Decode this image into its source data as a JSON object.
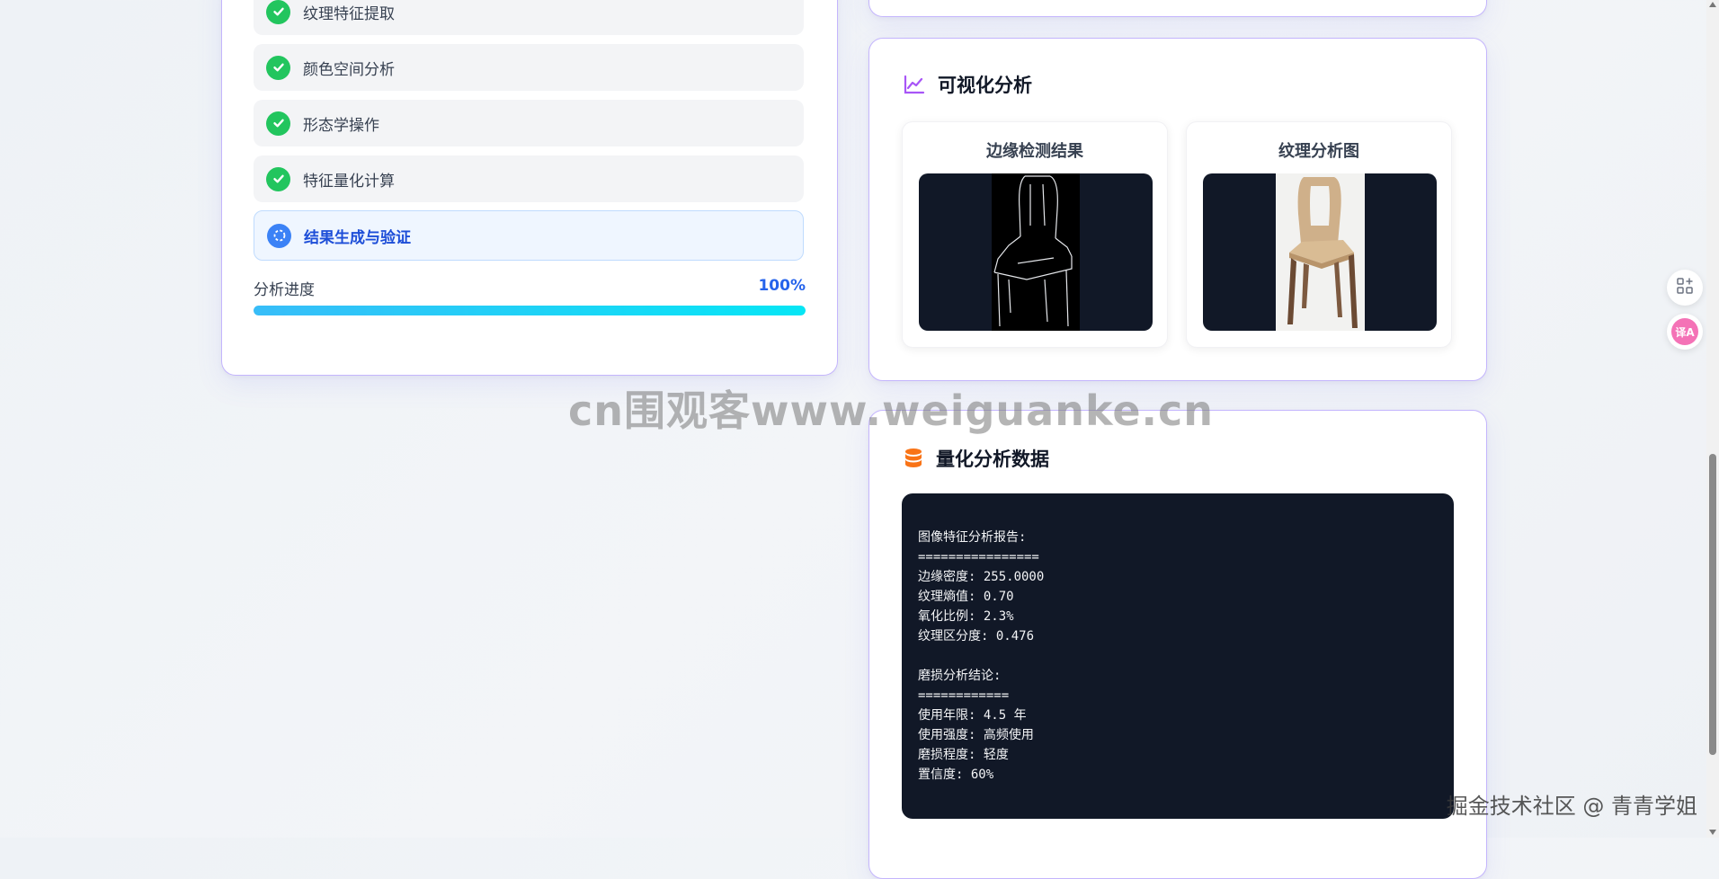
{
  "steps": {
    "items": [
      {
        "label": "纹理特征提取",
        "status": "done"
      },
      {
        "label": "颜色空间分析",
        "status": "done"
      },
      {
        "label": "形态学操作",
        "status": "done"
      },
      {
        "label": "特征量化计算",
        "status": "done"
      },
      {
        "label": "结果生成与验证",
        "status": "active"
      }
    ],
    "progress_label": "分析进度",
    "progress_value": "100%",
    "progress_fraction": 1.0
  },
  "visualization": {
    "title": "可视化分析",
    "panels": [
      {
        "title": "边缘检测结果"
      },
      {
        "title": "纹理分析图"
      }
    ]
  },
  "data_card": {
    "title": "量化分析数据",
    "report": "图像特征分析报告:\n================\n边缘密度: 255.0000\n纹理熵值: 0.70\n氧化比例: 2.3%\n纹理区分度: 0.476\n\n磨损分析结论:\n============\n使用年限: 4.5 年\n使用强度: 高频使用\n磨损程度: 轻度\n置信度: 60%"
  },
  "watermark": "cn围观客www.weiguanke.cn",
  "credit": "掘金技术社区 @ 青青学姐",
  "floating": {
    "translate_badge": "译A"
  },
  "colors": {
    "accent_green": "#22c55e",
    "accent_blue": "#2563eb",
    "progress_start": "#38bdf8",
    "progress_end": "#06e6f5",
    "card_border": "#c4b5fd",
    "terminal_bg": "#111827"
  }
}
